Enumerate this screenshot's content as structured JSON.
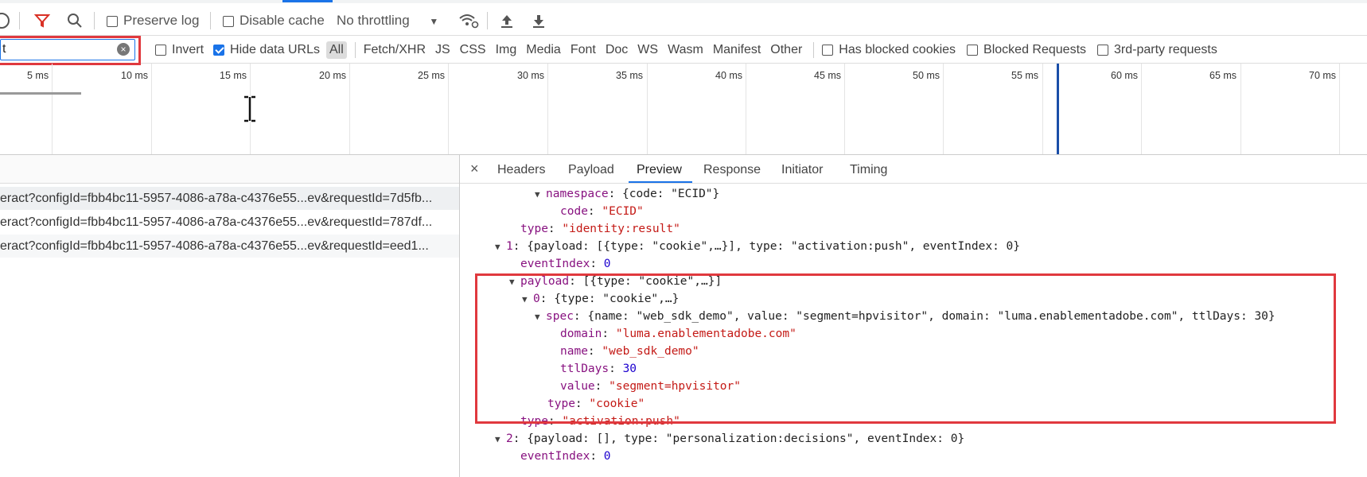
{
  "toolbar": {
    "preserve_log": "Preserve log",
    "disable_cache": "Disable cache",
    "throttling": "No throttling"
  },
  "filterbar": {
    "filter_value": "t",
    "invert": "Invert",
    "hide_data_urls": "Hide data URLs",
    "types": [
      "All",
      "Fetch/XHR",
      "JS",
      "CSS",
      "Img",
      "Media",
      "Font",
      "Doc",
      "WS",
      "Wasm",
      "Manifest",
      "Other"
    ],
    "has_blocked_cookies": "Has blocked cookies",
    "blocked_requests": "Blocked Requests",
    "third_party": "3rd-party requests"
  },
  "timeline": {
    "ticks": [
      "5 ms",
      "10 ms",
      "15 ms",
      "20 ms",
      "25 ms",
      "30 ms",
      "35 ms",
      "40 ms",
      "45 ms",
      "50 ms",
      "55 ms",
      "60 ms",
      "65 ms",
      "70 ms"
    ]
  },
  "requests": [
    "eract?configId=fbb4bc11-5957-4086-a78a-c4376e55...ev&requestId=7d5fb...",
    "eract?configId=fbb4bc11-5957-4086-a78a-c4376e55...ev&requestId=787df...",
    "eract?configId=fbb4bc11-5957-4086-a78a-c4376e55...ev&requestId=eed1..."
  ],
  "details": {
    "close": "×",
    "tabs": [
      "Headers",
      "Payload",
      "Preview",
      "Response",
      "Initiator",
      "Timing"
    ],
    "active_tab": "Preview"
  },
  "preview": {
    "l1_key": "namespace",
    "l1_val": "{code: \"ECID\"}",
    "l2_key": "code",
    "l2_val": "\"ECID\"",
    "l3_key": "type",
    "l3_val": "\"identity:result\"",
    "l4_key": "1",
    "l4_val": "{payload: [{type: \"cookie\",…}], type: \"activation:push\", eventIndex: 0}",
    "l5_key": "eventIndex",
    "l5_val": "0",
    "l6_key": "payload",
    "l6_val": "[{type: \"cookie\",…}]",
    "l7_key": "0",
    "l7_val": "{type: \"cookie\",…}",
    "l8_key": "spec",
    "l8_val": "{name: \"web_sdk_demo\", value: \"segment=hpvisitor\", domain: \"luma.enablementadobe.com\", ttlDays: 30}",
    "l9_key": "domain",
    "l9_val": "\"luma.enablementadobe.com\"",
    "l10_key": "name",
    "l10_val": "\"web_sdk_demo\"",
    "l11_key": "ttlDays",
    "l11_val": "30",
    "l12_key": "value",
    "l12_val": "\"segment=hpvisitor\"",
    "l13_key": "type",
    "l13_val": "\"cookie\"",
    "l14_key": "type",
    "l14_val": "\"activation:push\"",
    "l15_key": "2",
    "l15_val": "{payload: [], type: \"personalization:decisions\", eventIndex: 0}",
    "l16_key": "eventIndex",
    "l16_val": "0"
  },
  "colors": {
    "highlight": "#e0393e",
    "active_tab": "#1a73e8",
    "timeline_marker": "#1a4ea8"
  }
}
